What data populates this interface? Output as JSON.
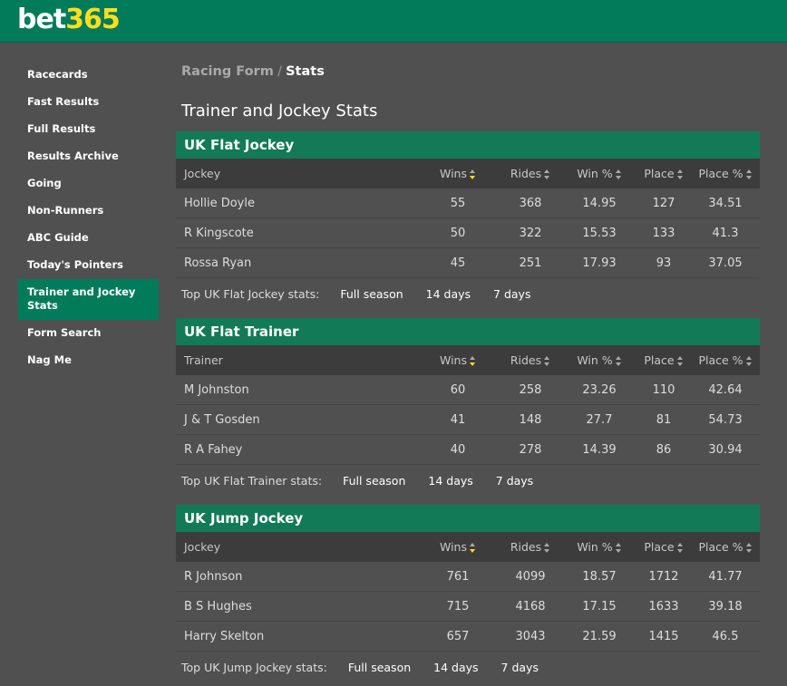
{
  "header": {
    "logo": {
      "part1": "bet",
      "part2": "365"
    },
    "colors": {
      "brand_green": "#027b5b",
      "brand_yellow": "#ffdf1b"
    }
  },
  "sidebar": {
    "items": [
      {
        "label": "Racecards",
        "active": false
      },
      {
        "label": "Fast Results",
        "active": false
      },
      {
        "label": "Full Results",
        "active": false
      },
      {
        "label": "Results Archive",
        "active": false
      },
      {
        "label": "Going",
        "active": false
      },
      {
        "label": "Non-Runners",
        "active": false
      },
      {
        "label": "ABC Guide",
        "active": false
      },
      {
        "label": "Today's Pointers",
        "active": false
      },
      {
        "label": "Trainer and Jockey Stats",
        "active": true
      },
      {
        "label": "Form Search",
        "active": false
      },
      {
        "label": "Nag Me",
        "active": false
      }
    ]
  },
  "breadcrumb": {
    "parent": "Racing Form",
    "separator": "/",
    "current": "Stats"
  },
  "page_title": "Trainer and Jockey Stats",
  "sections": [
    {
      "title": "UK Flat Jockey",
      "columns": {
        "name": "Jockey",
        "wins": "Wins",
        "rides": "Rides",
        "win_pct": "Win %",
        "place": "Place",
        "place_pct": "Place %"
      },
      "rows": [
        {
          "name": "Hollie Doyle",
          "wins": "55",
          "rides": "368",
          "win_pct": "14.95",
          "place": "127",
          "place_pct": "34.51"
        },
        {
          "name": "R Kingscote",
          "wins": "50",
          "rides": "322",
          "win_pct": "15.53",
          "place": "133",
          "place_pct": "41.3"
        },
        {
          "name": "Rossa Ryan",
          "wins": "45",
          "rides": "251",
          "win_pct": "17.93",
          "place": "93",
          "place_pct": "37.05"
        }
      ],
      "footer": {
        "label": "Top UK Flat Jockey stats:",
        "links": [
          "Full season",
          "14 days",
          "7 days"
        ]
      }
    },
    {
      "title": "UK Flat Trainer",
      "columns": {
        "name": "Trainer",
        "wins": "Wins",
        "rides": "Rides",
        "win_pct": "Win %",
        "place": "Place",
        "place_pct": "Place %"
      },
      "rows": [
        {
          "name": "M Johnston",
          "wins": "60",
          "rides": "258",
          "win_pct": "23.26",
          "place": "110",
          "place_pct": "42.64"
        },
        {
          "name": "J & T Gosden",
          "wins": "41",
          "rides": "148",
          "win_pct": "27.7",
          "place": "81",
          "place_pct": "54.73"
        },
        {
          "name": "R A Fahey",
          "wins": "40",
          "rides": "278",
          "win_pct": "14.39",
          "place": "86",
          "place_pct": "30.94"
        }
      ],
      "footer": {
        "label": "Top UK Flat Trainer stats:",
        "links": [
          "Full season",
          "14 days",
          "7 days"
        ]
      }
    },
    {
      "title": "UK Jump Jockey",
      "columns": {
        "name": "Jockey",
        "wins": "Wins",
        "rides": "Rides",
        "win_pct": "Win %",
        "place": "Place",
        "place_pct": "Place %"
      },
      "rows": [
        {
          "name": "R Johnson",
          "wins": "761",
          "rides": "4099",
          "win_pct": "18.57",
          "place": "1712",
          "place_pct": "41.77"
        },
        {
          "name": "B S Hughes",
          "wins": "715",
          "rides": "4168",
          "win_pct": "17.15",
          "place": "1633",
          "place_pct": "39.18"
        },
        {
          "name": "Harry Skelton",
          "wins": "657",
          "rides": "3043",
          "win_pct": "21.59",
          "place": "1415",
          "place_pct": "46.5"
        }
      ],
      "footer": {
        "label": "Top UK Jump Jockey stats:",
        "links": [
          "Full season",
          "14 days",
          "7 days"
        ]
      }
    }
  ]
}
